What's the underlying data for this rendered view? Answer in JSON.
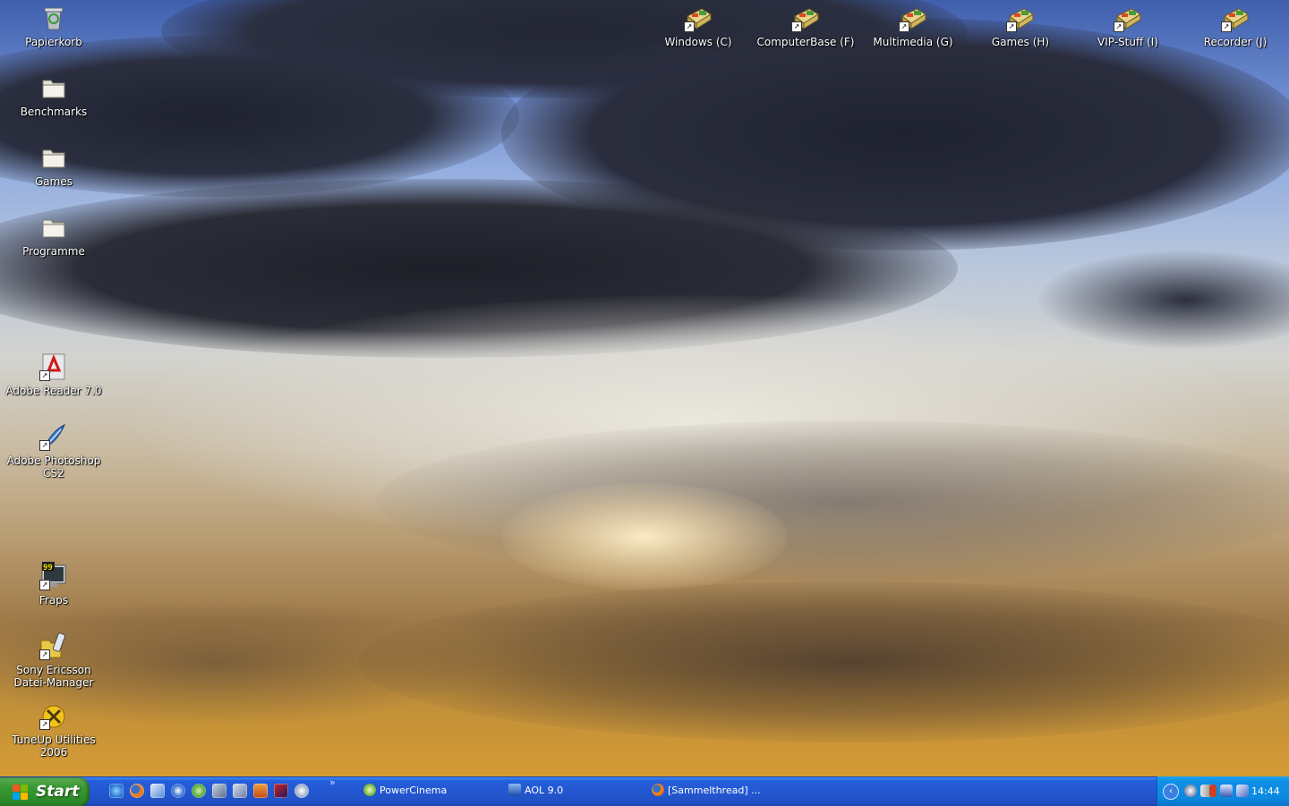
{
  "desktop": {
    "left_icons": [
      {
        "label": "Papierkorb",
        "icon": "recycle-bin-icon"
      },
      {
        "label": "Benchmarks",
        "icon": "folder-icon"
      },
      {
        "label": "Games",
        "icon": "folder-icon"
      },
      {
        "label": "Programme",
        "icon": "folder-icon"
      },
      {
        "label": "Adobe Reader 7.0",
        "icon": "adobe-reader-icon"
      },
      {
        "label": "Adobe Photoshop CS2",
        "icon": "photoshop-feather-icon"
      },
      {
        "label": "Fraps",
        "icon": "fraps-icon"
      },
      {
        "label": "Sony Ericsson Datei-Manager",
        "icon": "sony-ericsson-folder-phone-icon"
      },
      {
        "label": "TuneUp Utilities 2006",
        "icon": "tuneup-icon"
      }
    ],
    "top_icons": [
      {
        "label": "Windows (C)",
        "icon": "drive-shortcut-icon"
      },
      {
        "label": "ComputerBase (F)",
        "icon": "drive-shortcut-icon"
      },
      {
        "label": "Multimedia (G)",
        "icon": "drive-shortcut-icon"
      },
      {
        "label": "Games (H)",
        "icon": "drive-shortcut-icon"
      },
      {
        "label": "VIP-Stuff (I)",
        "icon": "drive-shortcut-icon"
      },
      {
        "label": "Recorder (J)",
        "icon": "drive-shortcut-icon"
      }
    ]
  },
  "taskbar": {
    "start_label": "Start",
    "quick_launch": [
      "internet-explorer-icon",
      "firefox-icon",
      "outlook-express-icon",
      "media-player-icon",
      "realplayer-icon",
      "teamspeak-icon",
      "headset-icon",
      "image-viewer-icon",
      "game-icon",
      "network-icon"
    ],
    "chevron": "»",
    "tasks": [
      {
        "label": "PowerCinema",
        "icon": "powercinema-icon"
      },
      {
        "label": "AOL 9.0",
        "icon": "aol-icon"
      },
      {
        "label": "[Sammelthread] ...",
        "icon": "firefox-icon"
      }
    ],
    "tray": {
      "expand_glyph": "‹",
      "icons": [
        "network-globe-icon",
        "printer-icon",
        "volume-icon",
        "display-icon",
        "network-connection-icon"
      ],
      "clock": "14:44"
    }
  },
  "colors": {
    "taskbar_blue": "#245edb",
    "start_green": "#3c9b35",
    "tray_blue": "#0f8ee6"
  }
}
